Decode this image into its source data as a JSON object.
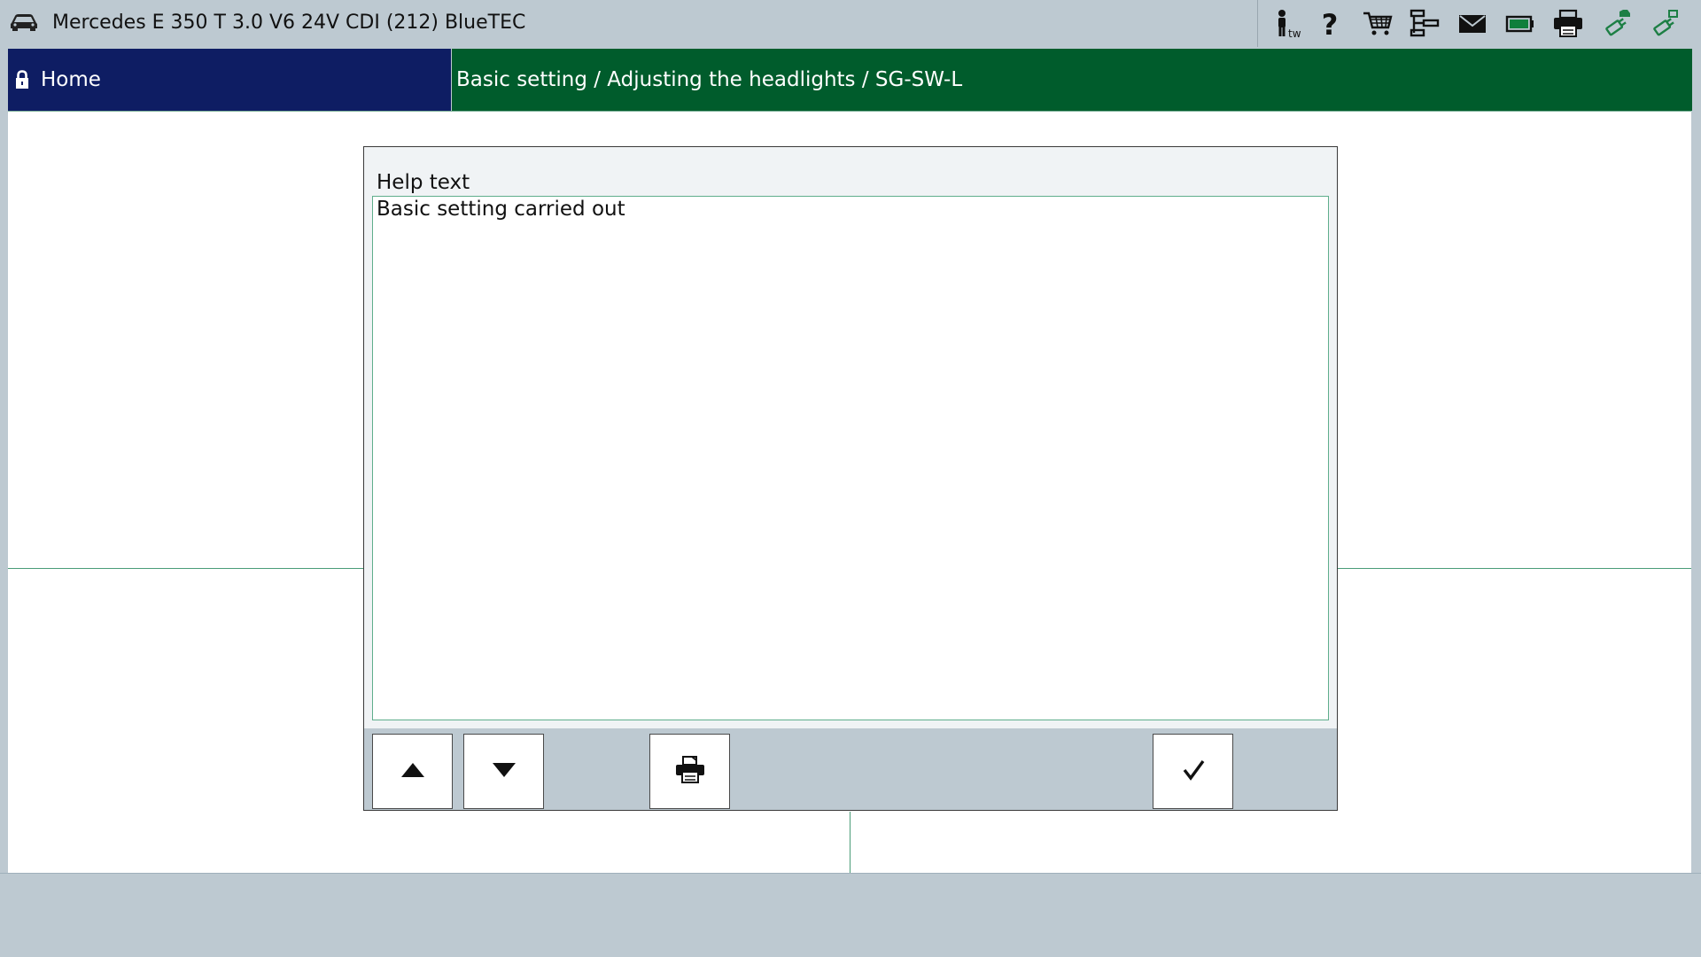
{
  "topbar": {
    "vehicle_title": "Mercedes E 350 T 3.0 V6 24V CDI (212) BlueTEC",
    "user_suffix": "tw",
    "help_glyph": "?",
    "icons": [
      "car-icon",
      "user-icon",
      "help-icon",
      "cart-icon",
      "network-icon",
      "mail-icon",
      "battery-icon",
      "printer-icon",
      "vehicle-connection-icon",
      "connection-icon"
    ],
    "accent_colors": {
      "battery": "#0f7f3c",
      "connection": "#1d7f45"
    }
  },
  "header": {
    "home_label": "Home",
    "breadcrumb": "Basic setting / Adjusting the headlights / SG-SW-L",
    "colors": {
      "home_bg": "#0e1d63",
      "breadcrumb_bg": "#005c2c"
    }
  },
  "dialog": {
    "title": "Help text",
    "body_lines": [
      "Basic setting carried out"
    ],
    "buttons": [
      {
        "name": "scroll-up-button",
        "icon": "arrow-up-icon"
      },
      {
        "name": "scroll-down-button",
        "icon": "arrow-down-icon"
      },
      {
        "name": "print-button",
        "icon": "printer-icon"
      },
      {
        "name": "confirm-button",
        "icon": "checkmark-icon"
      }
    ]
  }
}
